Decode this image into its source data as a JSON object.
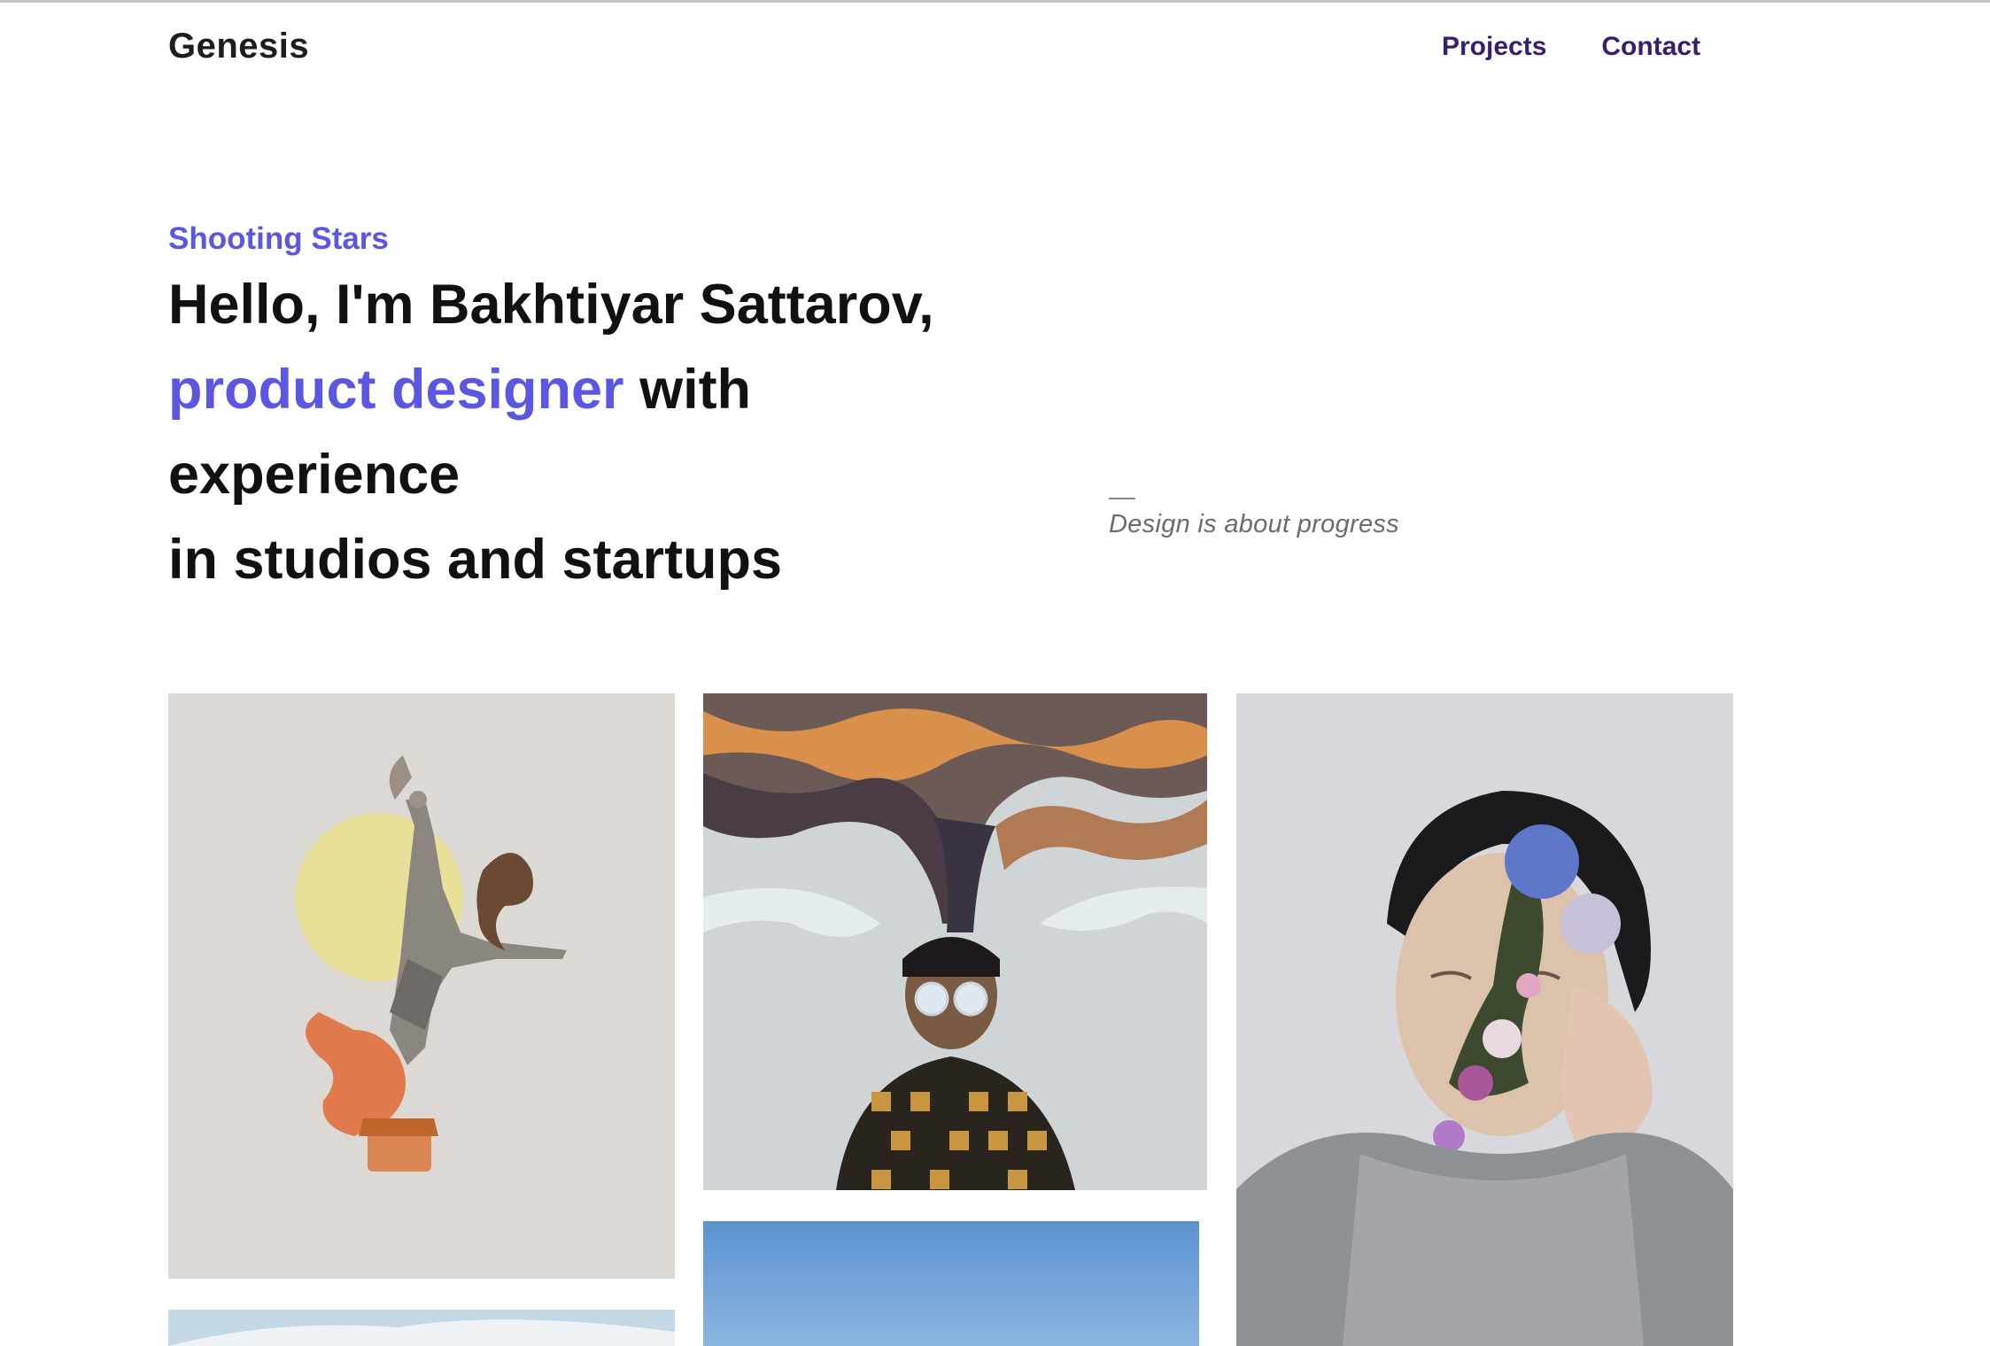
{
  "header": {
    "logo": "Genesis",
    "nav": [
      {
        "label": "Projects"
      },
      {
        "label": "Contact"
      }
    ]
  },
  "hero": {
    "eyebrow": "Shooting Stars",
    "headline_line1": "Hello, I'm Bakhtiyar Sattarov,",
    "headline_accent": "product designer",
    "headline_line2_rest": " with",
    "headline_line3": "experience",
    "headline_line4": "in studios and startups",
    "quote": "Design is about progress"
  },
  "colors": {
    "accent": "#5b57e3",
    "nav": "#3b1d6e",
    "text": "#111111"
  }
}
